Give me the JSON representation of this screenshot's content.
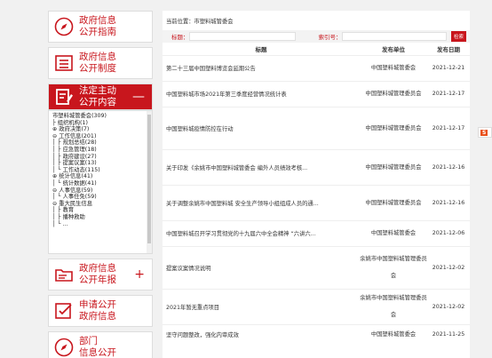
{
  "left_nav": {
    "guide": {
      "line1": "政府信息",
      "line2": "公开指南"
    },
    "system": {
      "line1": "政府信息",
      "line2": "公开制度"
    },
    "active": {
      "line1": "法定主动",
      "line2": "公开内容",
      "toggle": "—"
    },
    "annual": {
      "line1": "政府信息",
      "line2": "公开年报",
      "toggle": "+"
    },
    "apply": {
      "line1": "申请公开",
      "line2": "政府信息"
    },
    "dept": {
      "line1": "部门",
      "line2": "信息公开"
    }
  },
  "tree": [
    "市塑料城管委会(309)",
    "├ 组织机构(1)",
    "⊕ 政府决策(7)",
    "⊖ 工作信息(201)",
    "│ ├ 规划总结(28)",
    "│ ├ 应急管理(18)",
    "│ ├ 政府建设(27)",
    "│ ├ 提案议案(13)",
    "│ └ 工作动态(115)",
    "⊕ 统计信息(41)",
    "│ └ 统计数据(41)",
    "⊖ 人事信息(59)",
    "│ └ 人事任免(59)",
    "⊖ 重大民生信息",
    "│ ├ 教育",
    "│ ├ 播种救助",
    "│ └ ..."
  ],
  "main": {
    "breadcrumb": "当前位置：市塑料城管委会",
    "search": {
      "title_label": "标题：",
      "index_label": "索引号：",
      "button": "检索"
    },
    "columns": [
      "标题",
      "发布单位",
      "发布日期"
    ],
    "rows": [
      {
        "title": "第二十三届中国塑料博览会延期公告",
        "pub": "中国塑料城管委会",
        "date": "2021-12-21"
      },
      {
        "title": "中国塑料城市场2021年第三季度经营情况统计表",
        "pub": "中国塑料城管理委员会",
        "date": "2021-12-17"
      },
      {
        "title": "中国塑料城疫情防控在行动",
        "pub": "中国塑料城管理委员会",
        "date": "2021-12-17"
      },
      {
        "title": "关于印发《余姚市中国塑料城管委会 编外人员绩效考核...",
        "pub": "中国塑料城管理委员会",
        "date": "2021-12-16"
      },
      {
        "title": "关于调整余姚市中国塑料城 安全生产领导小组组成人员的通...",
        "pub": "中国塑料城管理委员会",
        "date": "2021-12-16"
      },
      {
        "title": "中国塑料城召开学习贯彻党的十九届六中全会精神 “六讲六...",
        "pub": "中国塑料城管委会",
        "date": "2021-12-06"
      },
      {
        "title": "提案议案情况说明",
        "pub": "余姚市中国塑料城管理委员会",
        "date": "2021-12-02"
      },
      {
        "title": "2021年暂无重点项目",
        "pub": "余姚市中国塑料城管理委员会",
        "date": "2021-12-02"
      },
      {
        "title": "坚守问题整改，强化内审成效",
        "pub": "中国塑料城管委会",
        "date": "2021-11-25"
      }
    ]
  },
  "float_icon": "S"
}
